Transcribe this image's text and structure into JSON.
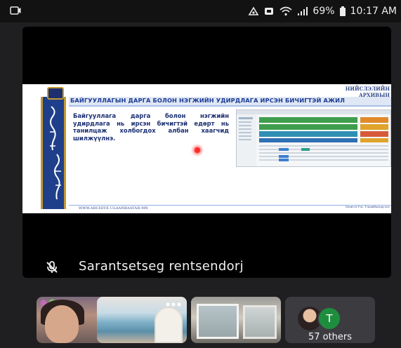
{
  "status_bar": {
    "battery": "69%",
    "time": "10:17 AM",
    "left_icon": "cast-icon",
    "right_icons": [
      "data-saver-icon",
      "notification-icon",
      "wifi-icon",
      "signal-icon",
      "battery-icon"
    ]
  },
  "main_speaker": {
    "name": "Sarantsetseg rentsendorj",
    "mic_state": "muted"
  },
  "slide": {
    "title": "БАЙГУУЛЛАГЫН ДАРГА БОЛОН НЭГЖИЙН УДИРДЛАГА ИРСЭН БИЧИГТЭЙ АЖИЛ",
    "body": "Байгууллага дарга болон нэгжийн удирдлага нь ирсэн бичигтэй едөрт нь танилцаж холбогдох албан хаагчид шилжүүлнэ.",
    "footer": "WWW.ARCHIVE.ULAANBAATAR.MN",
    "header_right": "НИЙСЛЭЛИЙН АРХИВЫН",
    "footer_right": "Монгол Улс, Улаанбаатар хот"
  },
  "participants": {
    "others_label": "57 others",
    "others_avatar_letter": "T"
  },
  "colors": {
    "background": "#1f1f21",
    "avatar_green": "#1e8e3e",
    "slide_blue": "#1a3a92"
  }
}
